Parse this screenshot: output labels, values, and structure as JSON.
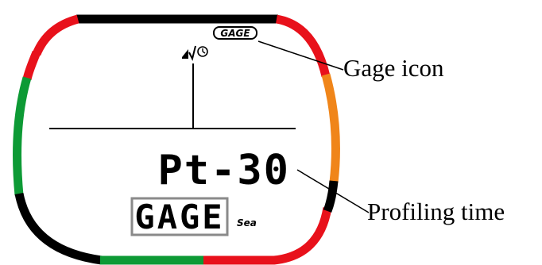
{
  "display": {
    "main_readout": "Pt-30",
    "mode_label": "GAGE",
    "water_type": "Sea",
    "gage_badge": "GAGE"
  },
  "callouts": {
    "gage_icon": "Gage icon",
    "profiling_time": "Profiling time"
  },
  "icons": [
    "ascent-arrow-icon",
    "safety-stop-check-icon",
    "clock-icon"
  ],
  "bezel_colors": {
    "red": "#e8111b",
    "green": "#0d9a35",
    "orange": "#f08519",
    "black": "#000000"
  }
}
